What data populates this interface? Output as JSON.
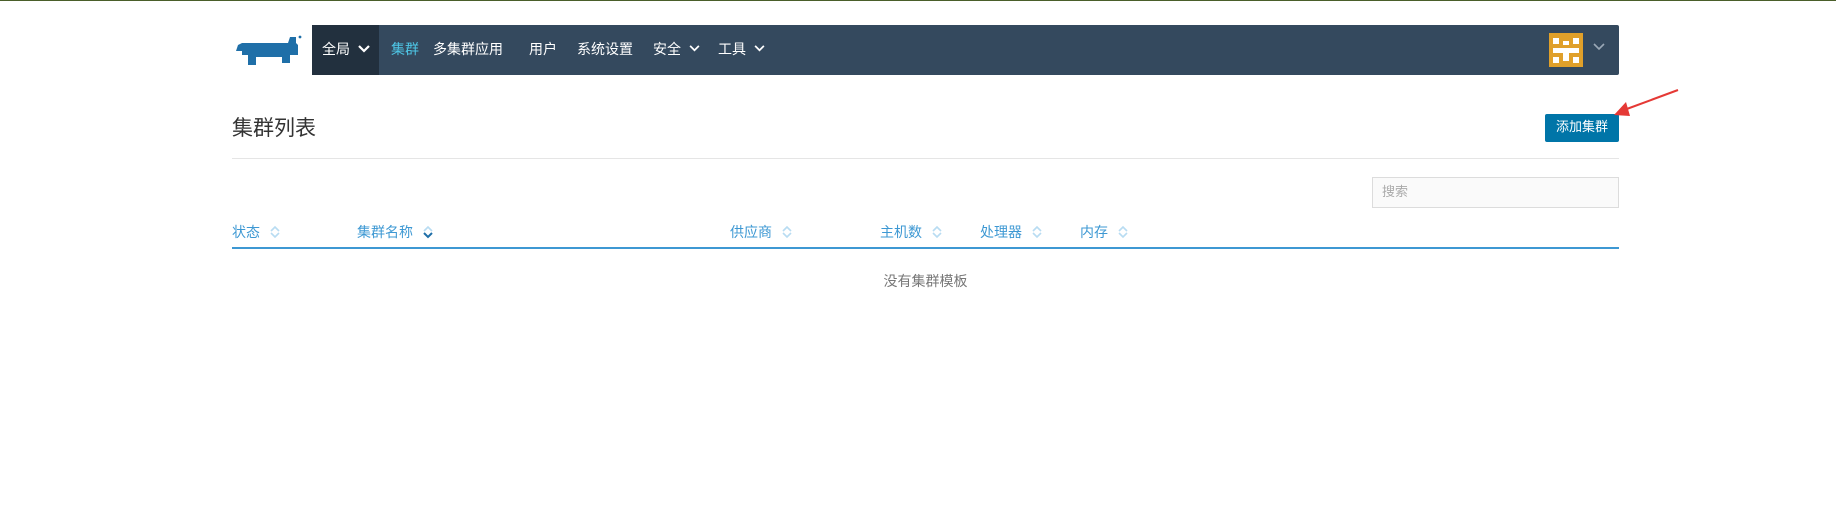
{
  "nav": {
    "scope": "全局",
    "items": [
      {
        "label": "集群",
        "active": true
      },
      {
        "label": "多集群应用"
      },
      {
        "label": "用户"
      },
      {
        "label": "系统设置"
      },
      {
        "label": "安全"
      },
      {
        "label": "工具"
      }
    ]
  },
  "page": {
    "title": "集群列表",
    "add_button": "添加集群"
  },
  "search": {
    "placeholder": "搜索"
  },
  "table": {
    "columns": [
      "状态",
      "集群名称",
      "供应商",
      "主机数",
      "处理器",
      "内存"
    ],
    "empty_message": "没有集群模板"
  },
  "colors": {
    "nav_bg": "#34495e",
    "nav_scope_bg": "#22303e",
    "nav_active": "#4ec6e6",
    "primary_button": "#0075a8",
    "column_header": "#3d98d3",
    "annotation_arrow": "#e53935",
    "avatar_bg": "#e0a02a"
  },
  "icons": {
    "logo": "rancher-cow-logo",
    "avatar": "identicon-avatar",
    "dropdown": "chevron-down-icon",
    "sort": "sort-icon"
  }
}
